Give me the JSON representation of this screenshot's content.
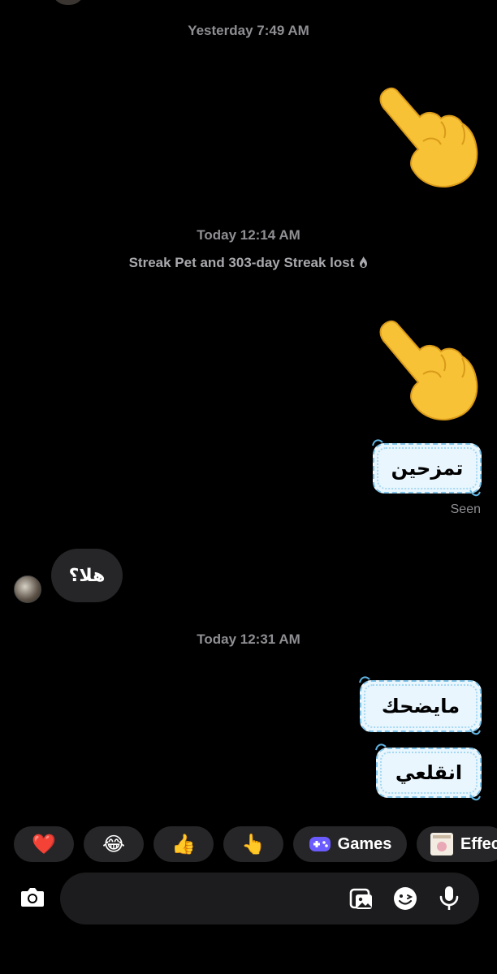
{
  "timestamps": {
    "first": "Yesterday 7:49 AM",
    "second": "Today 12:14 AM",
    "third": "Today 12:31 AM"
  },
  "system_message": "Streak Pet and 303-day Streak lost",
  "messages": {
    "sent_1": "تمزحين",
    "received_1": "هلا؟",
    "sent_2": "مايضحك",
    "sent_3": "انقلعي"
  },
  "status": {
    "seen": "Seen"
  },
  "quick_actions": {
    "heart": "❤️",
    "laugh": "😂",
    "thumbs_up": "👍",
    "point": "👆",
    "games_label": "Games",
    "effects_label": "Effec"
  },
  "composer": {
    "placeholder": ""
  },
  "icons": [
    "camera-icon",
    "gallery-icon",
    "sticker-icon",
    "microphone-icon",
    "gamepad-icon",
    "flame-icon"
  ],
  "colors": {
    "background": "#000000",
    "bubble_received": "#262628",
    "sticker_border": "#7fc3e8",
    "sticker_fill": "#e9f6fd",
    "muted_text": "#8e8e93",
    "games_accent": "#6b5cff"
  }
}
